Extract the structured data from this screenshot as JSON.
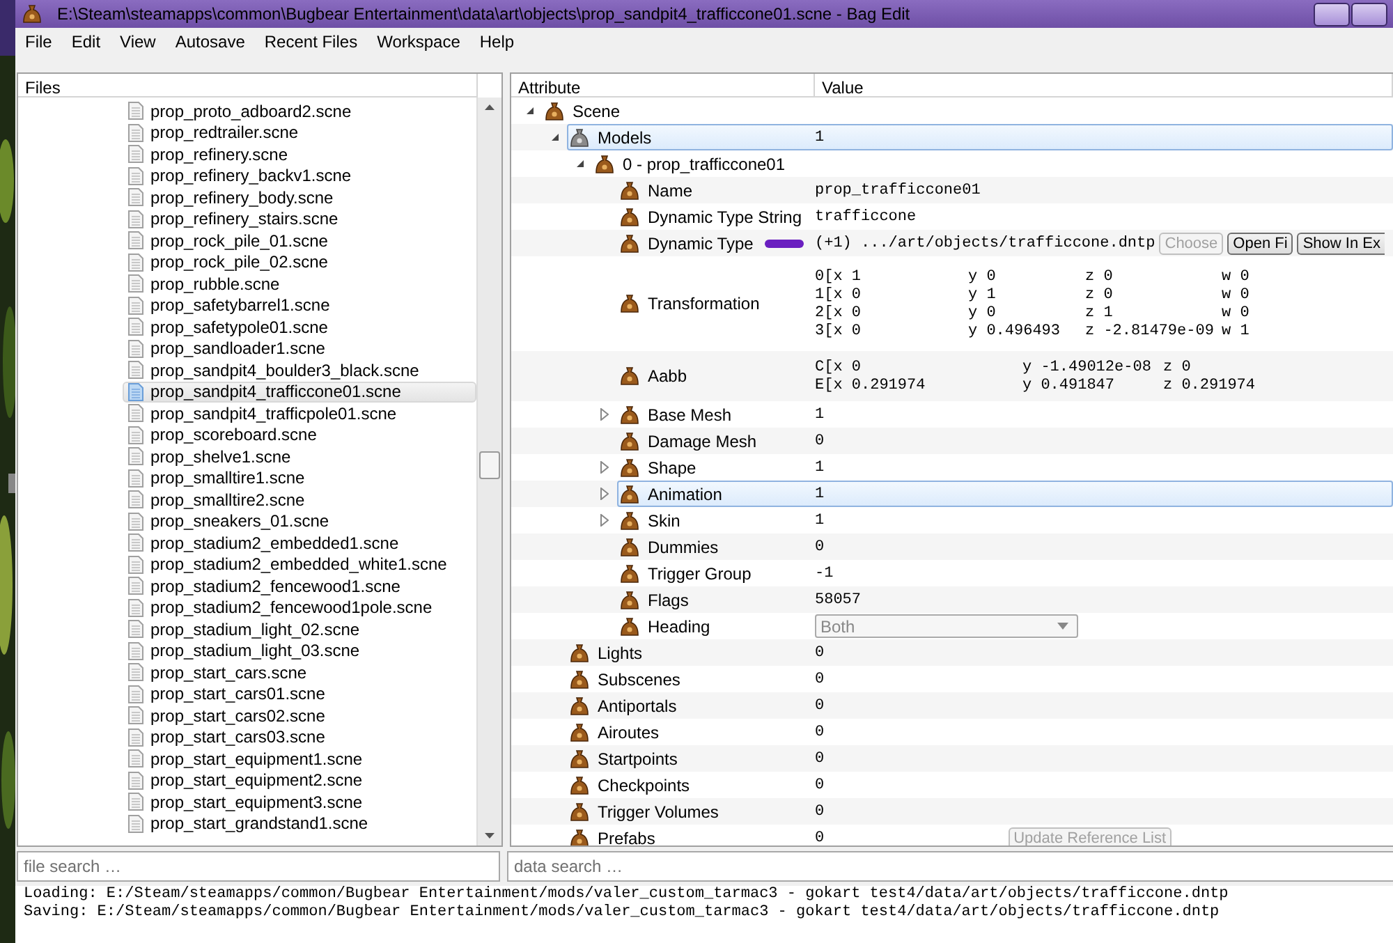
{
  "window": {
    "title": "E:\\Steam\\steamapps\\common\\Bugbear Entertainment\\data\\art\\objects\\prop_sandpit4_trafficcone01.scne - Bag Edit"
  },
  "menu": [
    "File",
    "Edit",
    "View",
    "Autosave",
    "Recent Files",
    "Workspace",
    "Help"
  ],
  "files": {
    "header": "Files",
    "items": [
      {
        "name": "prop_proto_adboard2.scne",
        "selected": false
      },
      {
        "name": "prop_redtrailer.scne",
        "selected": false
      },
      {
        "name": "prop_refinery.scne",
        "selected": false
      },
      {
        "name": "prop_refinery_backv1.scne",
        "selected": false
      },
      {
        "name": "prop_refinery_body.scne",
        "selected": false
      },
      {
        "name": "prop_refinery_stairs.scne",
        "selected": false
      },
      {
        "name": "prop_rock_pile_01.scne",
        "selected": false
      },
      {
        "name": "prop_rock_pile_02.scne",
        "selected": false
      },
      {
        "name": "prop_rubble.scne",
        "selected": false
      },
      {
        "name": "prop_safetybarrel1.scne",
        "selected": false
      },
      {
        "name": "prop_safetypole01.scne",
        "selected": false
      },
      {
        "name": "prop_sandloader1.scne",
        "selected": false
      },
      {
        "name": "prop_sandpit4_boulder3_black.scne",
        "selected": false
      },
      {
        "name": "prop_sandpit4_trafficcone01.scne",
        "selected": true
      },
      {
        "name": "prop_sandpit4_trafficpole01.scne",
        "selected": false
      },
      {
        "name": "prop_scoreboard.scne",
        "selected": false
      },
      {
        "name": "prop_shelve1.scne",
        "selected": false
      },
      {
        "name": "prop_smalltire1.scne",
        "selected": false
      },
      {
        "name": "prop_smalltire2.scne",
        "selected": false
      },
      {
        "name": "prop_sneakers_01.scne",
        "selected": false
      },
      {
        "name": "prop_stadium2_embedded1.scne",
        "selected": false
      },
      {
        "name": "prop_stadium2_embedded_white1.scne",
        "selected": false
      },
      {
        "name": "prop_stadium2_fencewood1.scne",
        "selected": false
      },
      {
        "name": "prop_stadium2_fencewood1pole.scne",
        "selected": false
      },
      {
        "name": "prop_stadium_light_02.scne",
        "selected": false
      },
      {
        "name": "prop_stadium_light_03.scne",
        "selected": false
      },
      {
        "name": "prop_start_cars.scne",
        "selected": false
      },
      {
        "name": "prop_start_cars01.scne",
        "selected": false
      },
      {
        "name": "prop_start_cars02.scne",
        "selected": false
      },
      {
        "name": "prop_start_cars03.scne",
        "selected": false
      },
      {
        "name": "prop_start_equipment1.scne",
        "selected": false
      },
      {
        "name": "prop_start_equipment2.scne",
        "selected": false
      },
      {
        "name": "prop_start_equipment3.scne",
        "selected": false
      },
      {
        "name": "prop_start_grandstand1.scne",
        "selected": false
      }
    ],
    "search_placeholder": "file search …"
  },
  "attributes": {
    "columns": [
      "Attribute",
      "Value"
    ],
    "search_placeholder": "data search …",
    "tree": [
      {
        "label": "Scene",
        "expanded": true,
        "selected": false,
        "children": [
          {
            "label": "Models",
            "kind": "value",
            "value": "1",
            "expanded": true,
            "selected": true,
            "children": [
              {
                "label": "0 - prop_trafficcone01",
                "expanded": true,
                "selected": false,
                "children": [
                  {
                    "label": "Name",
                    "kind": "value",
                    "value": "prop_trafficcone01",
                    "selected": false
                  },
                  {
                    "label": "Dynamic Type String",
                    "kind": "value",
                    "value": "trafficcone",
                    "selected": false
                  },
                  {
                    "label": "Dynamic Type",
                    "kind": "file",
                    "value": "(+1) .../art/objects/trafficcone.dntp",
                    "marked": true,
                    "selected": false,
                    "buttons": [
                      {
                        "label": "Choose",
                        "disabled": true
                      },
                      {
                        "label": "Open Fi",
                        "disabled": false
                      },
                      {
                        "label": "Show In Ex",
                        "disabled": false
                      }
                    ]
                  },
                  {
                    "label": "Transformation",
                    "kind": "matrix",
                    "selected": false,
                    "lines": [
                      [
                        "0[x 1",
                        "y 0",
                        "z 0",
                        "w 0"
                      ],
                      [
                        "1[x 0",
                        "y 1",
                        "z 0",
                        "w 0"
                      ],
                      [
                        "2[x 0",
                        "y 0",
                        "z 1",
                        "w 0"
                      ],
                      [
                        "3[x 0",
                        "y 0.496493",
                        "z -2.81479e-09",
                        "w 1"
                      ]
                    ]
                  },
                  {
                    "label": "Aabb",
                    "kind": "matrix",
                    "selected": false,
                    "lines": [
                      [
                        "C[x 0",
                        "y -1.49012e-08",
                        "z 0"
                      ],
                      [
                        "E[x 0.291974",
                        "y 0.491847",
                        "z 0.291974"
                      ]
                    ]
                  },
                  {
                    "label": "Base Mesh",
                    "kind": "value",
                    "value": "1",
                    "expanded": false,
                    "selected": false
                  },
                  {
                    "label": "Damage Mesh",
                    "kind": "value",
                    "value": "0",
                    "selected": false
                  },
                  {
                    "label": "Shape",
                    "kind": "value",
                    "value": "1",
                    "expanded": false,
                    "selected": false
                  },
                  {
                    "label": "Animation",
                    "kind": "value",
                    "value": "1",
                    "expanded": false,
                    "selected": true
                  },
                  {
                    "label": "Skin",
                    "kind": "value",
                    "value": "1",
                    "expanded": false,
                    "selected": false
                  },
                  {
                    "label": "Dummies",
                    "kind": "value",
                    "value": "0",
                    "selected": false
                  },
                  {
                    "label": "Trigger Group",
                    "kind": "value",
                    "value": "-1",
                    "selected": false
                  },
                  {
                    "label": "Flags",
                    "kind": "value",
                    "value": "58057",
                    "selected": false
                  },
                  {
                    "label": "Heading",
                    "kind": "dropdown",
                    "value": "Both",
                    "disabled": true,
                    "selected": false
                  }
                ]
              }
            ]
          },
          {
            "label": "Lights",
            "kind": "value",
            "value": "0",
            "selected": false
          },
          {
            "label": "Subscenes",
            "kind": "value",
            "value": "0",
            "selected": false
          },
          {
            "label": "Antiportals",
            "kind": "value",
            "value": "0",
            "selected": false
          },
          {
            "label": "Airoutes",
            "kind": "value",
            "value": "0",
            "selected": false
          },
          {
            "label": "Startpoints",
            "kind": "value",
            "value": "0",
            "selected": false
          },
          {
            "label": "Checkpoints",
            "kind": "value",
            "value": "0",
            "selected": false
          },
          {
            "label": "Trigger Volumes",
            "kind": "value",
            "value": "0",
            "selected": false
          },
          {
            "label": "Prefabs",
            "kind": "action",
            "value": "0",
            "selected": false,
            "button": {
              "label": "Update Reference List",
              "disabled": true
            }
          }
        ]
      }
    ]
  },
  "log": [
    "Loading: E:/Steam/steamapps/common/Bugbear Entertainment/mods/valer_custom_tarmac3 - gokart test4/data/art/objects/trafficcone.dntp",
    "Saving: E:/Steam/steamapps/common/Bugbear Entertainment/mods/valer_custom_tarmac3 - gokart test4/data/art/objects/trafficcone.dntp"
  ]
}
